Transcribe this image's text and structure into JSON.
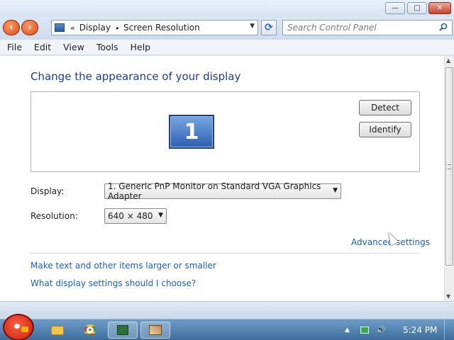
{
  "window": {
    "controls": {
      "minimize": "—",
      "maximize": "□",
      "close": "✕"
    }
  },
  "address_bar": {
    "separator": "«",
    "crumbs": [
      "Display",
      "Screen Resolution"
    ],
    "crumb_arrow": "▸",
    "dropdown": "▼",
    "refresh": "⟳"
  },
  "search": {
    "placeholder": "Search Control Panel"
  },
  "menu": [
    "File",
    "Edit",
    "View",
    "Tools",
    "Help"
  ],
  "main": {
    "title": "Change the appearance of your display",
    "monitor_number": "1",
    "detect_label": "Detect",
    "identify_label": "Identify",
    "display_label": "Display:",
    "display_value": "1. Generic PnP Monitor on Standard VGA Graphics Adapter",
    "resolution_label": "Resolution:",
    "resolution_value": "640 × 480",
    "advanced_link": "Advanced settings",
    "link_larger": "Make text and other items larger or smaller",
    "link_which": "What display settings should I choose?"
  },
  "taskbar": {
    "clock": "5:24 PM",
    "tray_up": "▲",
    "tray_volume": "🔊"
  },
  "colors": {
    "link": "#1e5eb3",
    "title": "#1e3d8c",
    "taskbar": "#4a7aa8"
  }
}
